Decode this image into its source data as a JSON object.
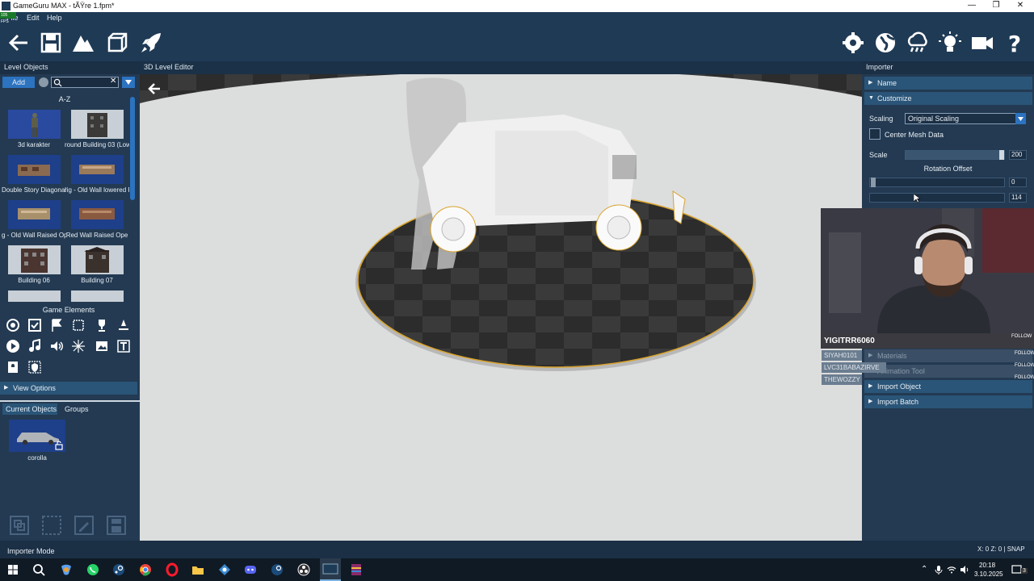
{
  "window": {
    "title": "GameGuru MAX - tÃŸre 1.fpm*",
    "fps": "105 FPS"
  },
  "menu": {
    "file": "File",
    "edit": "Edit",
    "help": "Help"
  },
  "toolbar": {
    "left_icons": [
      "back-arrow-icon",
      "save-icon",
      "terrain-mountain-icon",
      "object-cube-icon",
      "test-game-rocket-icon"
    ],
    "right_icons": [
      "game-settings-icon",
      "globe-icon",
      "weather-icon",
      "lighting-bulb-icon",
      "camera-icon",
      "help-question-icon"
    ]
  },
  "level_objects": {
    "header": "Level Objects",
    "add_label": "Add",
    "sort_label": "A-Z",
    "items": [
      {
        "label": "3d karakter",
        "color": "#2a4aa0"
      },
      {
        "label": "round Building 03 (Low",
        "color": "#c8cfd6"
      },
      {
        "label": "Double Story Diagonal",
        "color": "#1e3f8a"
      },
      {
        "label": "rig - Old Wall lowered F",
        "color": "#1e3f8a"
      },
      {
        "label": "g - Old Wall Raised Ope",
        "color": "#1e3f8a"
      },
      {
        "label": "Red Wall Raised Ope",
        "color": "#1e3f8a"
      },
      {
        "label": "Building 06",
        "color": "#c8cfd6"
      },
      {
        "label": "Building 07",
        "color": "#c8cfd6"
      }
    ]
  },
  "game_elements": {
    "header": "Game Elements"
  },
  "view_options": {
    "label": "View Options"
  },
  "current_objects": {
    "tab_current": "Current Objects",
    "tab_groups": "Groups",
    "items": [
      {
        "label": "corolla"
      }
    ]
  },
  "viewport": {
    "header": "3D Level Editor"
  },
  "importer": {
    "header": "Importer",
    "name_label": "Name",
    "customize_label": "Customize",
    "scaling_label": "Scaling",
    "scaling_value": "Original Scaling",
    "center_mesh_label": "Center Mesh Data",
    "scale_label": "Scale",
    "scale_value": "200",
    "rotation_offset_label": "Rotation Offset",
    "rotation_x_value": "0",
    "rotation_y_value": "114",
    "materials_label": "Materials",
    "animation_tool_label": "Animation Tool",
    "import_object_label": "Import Object",
    "import_batch_label": "Import Batch"
  },
  "stream_overlay": {
    "main_name": "YIGITRR6060",
    "follow": "FOLLOW",
    "names": [
      "SIYAH0101",
      "LVC31BABAZIRVE",
      "THEWOZZY"
    ]
  },
  "status": {
    "mode": "Importer Mode",
    "coords": "X: 0 Z: 0 | SNAP"
  },
  "taskbar": {
    "time": "20:18",
    "date": "3.10.2025",
    "notif_count": "3"
  }
}
